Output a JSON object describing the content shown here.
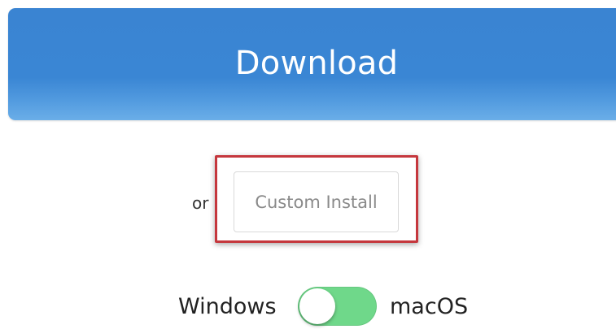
{
  "download": {
    "label": "Download"
  },
  "alternate": {
    "or_label": "or",
    "custom_install_label": "Custom Install",
    "highlight_color": "#c5373d"
  },
  "os_switch": {
    "left_label": "Windows",
    "right_label": "macOS",
    "toggle_on_color": "#6fd88a",
    "selected": "Windows"
  },
  "colors": {
    "download_blue": "#3a86d4"
  }
}
